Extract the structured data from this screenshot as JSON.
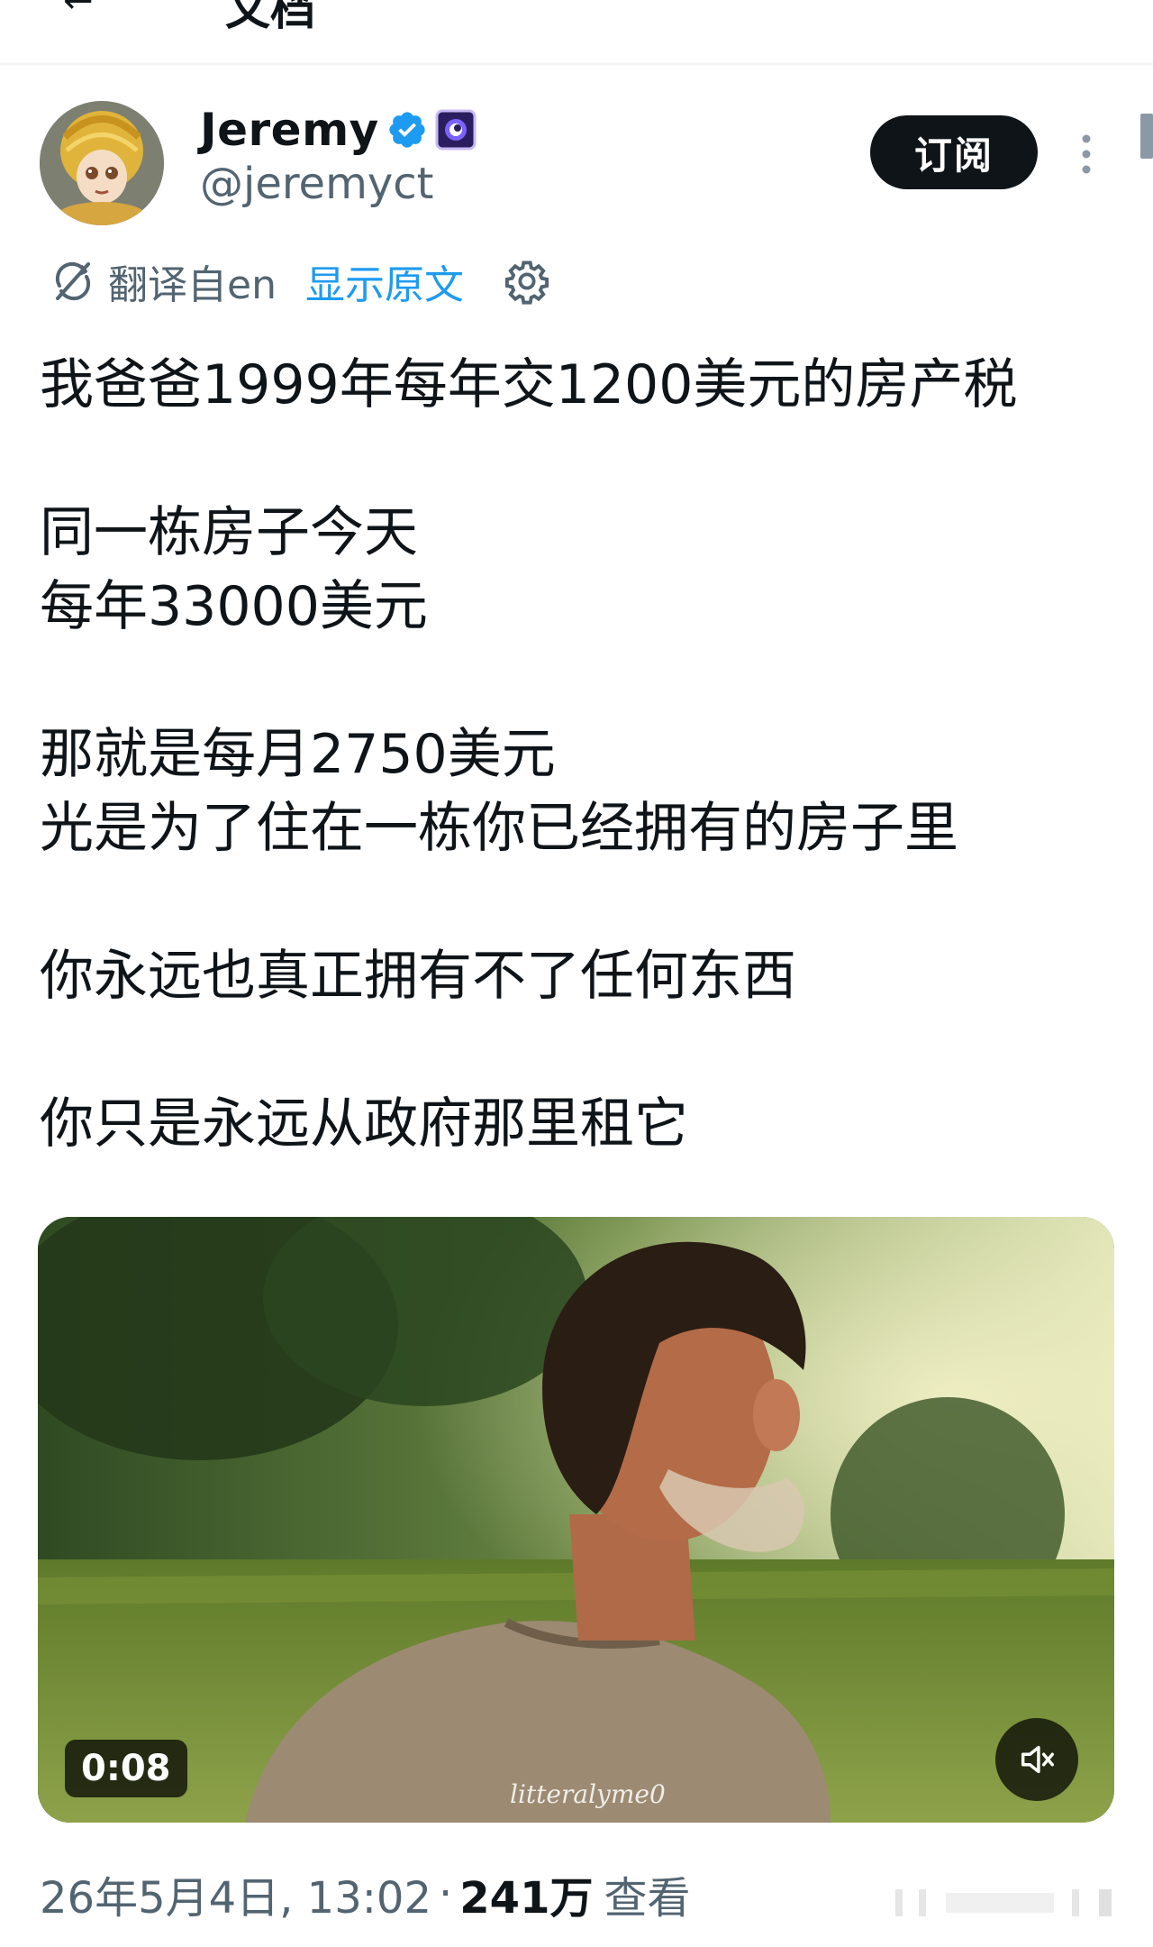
{
  "topbar": {
    "back_glyph": "←",
    "title": "文档"
  },
  "author": {
    "display_name": "Jeremy",
    "handle": "@jeremyct",
    "verified_icon": "verified-badge-icon",
    "affiliation_icon": "affiliate-badge-icon"
  },
  "subscribe_label": "订阅",
  "translation": {
    "translated_from": "翻译自en",
    "show_original": "显示原文"
  },
  "post": {
    "lines": [
      "我爸爸1999年每年交1200美元的房产税",
      "",
      "同一栋房子今天",
      "每年33000美元",
      "",
      "那就是每月2750美元",
      "光是为了住在一栋你已经拥有的房子里",
      "",
      "你永远也真正拥有不了任何东西",
      "",
      "你只是永远从政府那里租它"
    ]
  },
  "media": {
    "duration": "0:08",
    "watermark": "litteralyme0",
    "mute_icon": "speaker-muted-icon"
  },
  "meta": {
    "date": "26年5月4日, 13:02",
    "separator": "·",
    "views": "241万",
    "views_label": "查看"
  },
  "colors": {
    "accent": "#1d9bf0",
    "text_primary": "#0f1419",
    "text_secondary": "#536471",
    "button_dark": "#0f1419"
  }
}
